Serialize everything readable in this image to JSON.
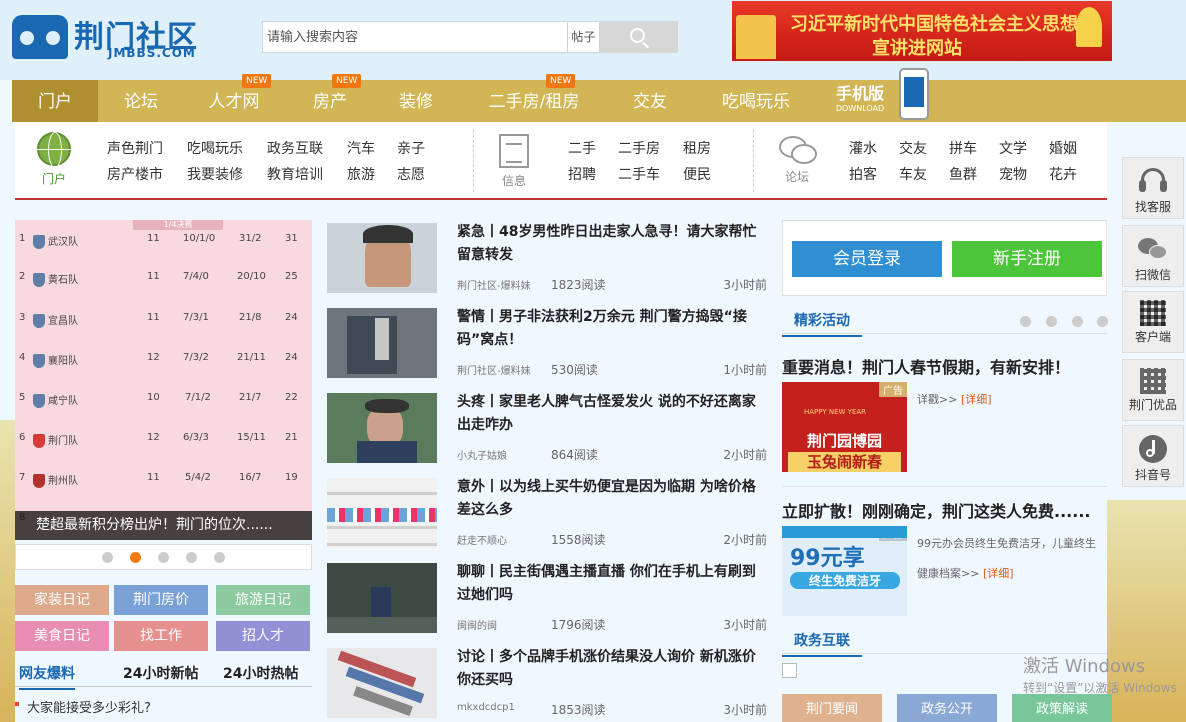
{
  "logo": {
    "cn": "荆门社区",
    "en": "JMBBS.COM"
  },
  "search": {
    "placeholder": "请输入搜索内容",
    "type": "帖子"
  },
  "banner": {
    "line1": "习近平新时代中国特色社会主义思想",
    "line2": "宣讲进网站"
  },
  "nav": {
    "items": [
      {
        "label": "门户"
      },
      {
        "label": "论坛"
      },
      {
        "label": "人才网",
        "badge": "NEW"
      },
      {
        "label": "房产",
        "badge": "NEW"
      },
      {
        "label": "装修"
      },
      {
        "label": "二手房/租房",
        "badge": "NEW"
      },
      {
        "label": "交友"
      },
      {
        "label": "吃喝玩乐"
      }
    ],
    "mobile": {
      "title": "手机版",
      "sub": "DOWNLOAD"
    }
  },
  "cats": {
    "portal": {
      "label": "门户",
      "links": [
        "声色荆门",
        "吃喝玩乐",
        "政务互联",
        "汽车",
        "亲子",
        "房产楼市",
        "我要装修",
        "教育培训",
        "旅游",
        "志愿"
      ]
    },
    "info": {
      "label": "信息",
      "links": [
        "二手",
        "二手房",
        "租房",
        "招聘",
        "二手车",
        "便民"
      ]
    },
    "forum": {
      "label": "论坛",
      "links": [
        "灌水",
        "交友",
        "拼车",
        "文学",
        "婚姻",
        "拍客",
        "车友",
        "鱼群",
        "宠物",
        "花卉"
      ]
    }
  },
  "rank": {
    "header": "1/4决赛",
    "rows": [
      {
        "no": "1",
        "team": "武汉队",
        "p": "11",
        "wdl": "10/1/0",
        "g": "31/2",
        "pts": "31"
      },
      {
        "no": "2",
        "team": "黄石队",
        "p": "11",
        "wdl": "7/4/0",
        "g": "20/10",
        "pts": "25"
      },
      {
        "no": "3",
        "team": "宜昌队",
        "p": "11",
        "wdl": "7/3/1",
        "g": "21/8",
        "pts": "24"
      },
      {
        "no": "4",
        "team": "襄阳队",
        "p": "12",
        "wdl": "7/3/2",
        "g": "21/11",
        "pts": "24"
      },
      {
        "no": "5",
        "team": "咸宁队",
        "p": "10",
        "wdl": "7/1/2",
        "g": "21/7",
        "pts": "22"
      },
      {
        "no": "6",
        "team": "荆门队",
        "p": "12",
        "wdl": "6/3/3",
        "g": "15/11",
        "pts": "21"
      },
      {
        "no": "7",
        "team": "荆州队",
        "p": "11",
        "wdl": "5/4/2",
        "g": "16/7",
        "pts": "19"
      },
      {
        "no": "8",
        "team": "",
        "p": "",
        "wdl": "",
        "g": "",
        "pts": ""
      }
    ],
    "caption": "楚超最新积分榜出炉！荆门的位次......",
    "slide_index": 2,
    "slide_count": 5
  },
  "tags": [
    {
      "label": "家装日记",
      "color": "#dda98a"
    },
    {
      "label": "荆门房价",
      "color": "#7aa1d6"
    },
    {
      "label": "旅游日记",
      "color": "#8ccaa0"
    },
    {
      "label": "美食日记",
      "color": "#e88fb1"
    },
    {
      "label": "找工作",
      "color": "#e58f8f"
    },
    {
      "label": "招人才",
      "color": "#9391d6"
    }
  ],
  "tabs3": [
    "网友爆料",
    "24小时新帖",
    "24小时热帖"
  ],
  "bullet": "大家能接受多少彩礼?",
  "news": [
    {
      "title": "紧急丨48岁男性昨日出走家人急寻！请大家帮忙留意转发",
      "src": "荆门社区-爆料妹",
      "reads": "1823阅读",
      "time": "3小时前"
    },
    {
      "title": "警情丨男子非法获利2万余元 荆门警方捣毁“接码”窝点！",
      "src": "荆门社区-爆料妹",
      "reads": "530阅读",
      "time": "1小时前"
    },
    {
      "title": "头疼丨家里老人脾气古怪爱发火 说的不好还离家出走咋办",
      "src": "小丸子姑娘",
      "reads": "864阅读",
      "time": "2小时前"
    },
    {
      "title": "意外丨以为线上买牛奶便宜是因为临期 为啥价格差这么多",
      "src": "赶走不顺心",
      "reads": "1558阅读",
      "time": "2小时前"
    },
    {
      "title": "聊聊丨民主街偶遇主播直播 你们在手机上有刷到过她们吗",
      "src": "闽闽的闽",
      "reads": "1796阅读",
      "time": "3小时前"
    },
    {
      "title": "讨论丨多个品牌手机涨价结果没人询价 新机涨价你还买吗",
      "src": "mkxdcdcp1",
      "reads": "1853阅读",
      "time": "3小时前"
    }
  ],
  "right": {
    "login": "会员登录",
    "register": "新手注册",
    "sec1": "精彩活动",
    "ev1": {
      "title": "重要消息！荆门人春节假期，有新安排！",
      "text": "详戳>>",
      "more": "[详细]",
      "img_lines": [
        "荆门园博园",
        "玉兔闹新春"
      ],
      "badge": "广告",
      "small": "HAPPY NEW YEAR"
    },
    "ev2": {
      "title": "立即扩散！刚刚确定，荆门这类人免费......",
      "text": "99元办会员终生免费洁牙，儿童终生",
      "more": "[详细]",
      "pre": "健康档案>>",
      "img_lines": [
        "99元享",
        "终生免费洁牙"
      ],
      "badge": "广告"
    },
    "sec2": "政务互联",
    "btabs": [
      "荆门要闻",
      "政务公开",
      "政策解读"
    ]
  },
  "side": [
    {
      "label": "找客服",
      "icon": "headset-icon"
    },
    {
      "label": "扫微信",
      "icon": "wechat-icon"
    },
    {
      "label": "客户端",
      "icon": "qrcode-icon"
    },
    {
      "label": "荆门优品",
      "icon": "qrcode-icon"
    },
    {
      "label": "抖音号",
      "icon": "tiktok-icon"
    }
  ],
  "watermark": {
    "l1": "激活 Windows",
    "l2": "转到“设置”以激活 Windows"
  }
}
